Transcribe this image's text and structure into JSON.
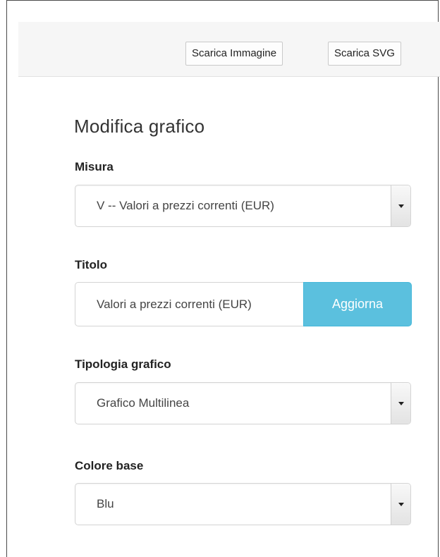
{
  "toolbar": {
    "download_image_label": "Scarica Immagine",
    "download_svg_label": "Scarica SVG"
  },
  "panel": {
    "title": "Modifica grafico",
    "measure": {
      "label": "Misura",
      "selected": "V -- Valori a prezzi correnti (EUR)"
    },
    "chart_title": {
      "label": "Titolo",
      "value": "Valori a prezzi correnti (EUR)",
      "button_label": "Aggiorna"
    },
    "chart_type": {
      "label": "Tipologia grafico",
      "selected": "Grafico Multilinea"
    },
    "base_color": {
      "label": "Colore base",
      "selected": "Blu"
    }
  },
  "icons": {
    "dropdown": "chevron-down-icon"
  },
  "colors": {
    "accent_button": "#5bc0de"
  }
}
